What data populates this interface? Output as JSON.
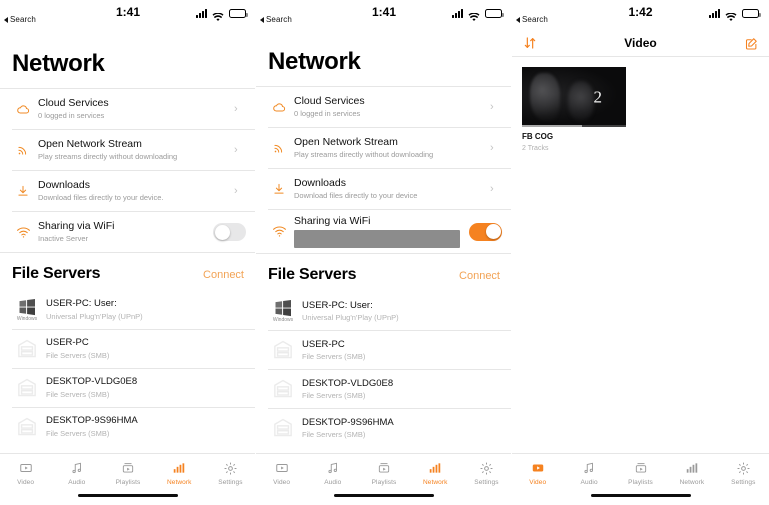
{
  "app": {
    "accent": "#f58220",
    "accent_light": "#f2a355",
    "muted": "#9a9a9a"
  },
  "panels": [
    {
      "id": "network-off",
      "status": {
        "time": "1:41",
        "back_label": "Search",
        "signal": "signal-bars",
        "wifi": "wifi-icon",
        "battery": "battery-icon"
      },
      "title": "Network",
      "rows": [
        {
          "icon": "cloud-icon",
          "title": "Cloud Services",
          "subtitle": "0 logged in services",
          "accessory": "chevron"
        },
        {
          "icon": "stream-icon",
          "title": "Open Network Stream",
          "subtitle": "Play streams directly without downloading",
          "accessory": "chevron"
        },
        {
          "icon": "download-icon",
          "title": "Downloads",
          "subtitle": "Download files directly to your device.",
          "accessory": "chevron"
        },
        {
          "icon": "wifi-icon",
          "title": "Sharing via WiFi",
          "subtitle": "Inactive Server",
          "accessory": "toggle",
          "toggle_on": false
        }
      ],
      "section": {
        "title": "File Servers",
        "action": "Connect"
      },
      "servers": [
        {
          "icon": "windows-logo",
          "name": "USER-PC: User:",
          "protocol": "Universal Plug'n'Play (UPnP)"
        },
        {
          "icon": "nas-icon",
          "name": "USER-PC",
          "protocol": "File Servers (SMB)"
        },
        {
          "icon": "nas-icon",
          "name": "DESKTOP-VLDG0E8",
          "protocol": "File Servers (SMB)"
        },
        {
          "icon": "nas-icon",
          "name": "DESKTOP-9S96HMA",
          "protocol": "File Servers (SMB)"
        }
      ],
      "tabs": [
        {
          "icon": "video-icon",
          "label": "Video",
          "active": false
        },
        {
          "icon": "audio-icon",
          "label": "Audio",
          "active": false
        },
        {
          "icon": "playlists-icon",
          "label": "Playlists",
          "active": false
        },
        {
          "icon": "network-icon",
          "label": "Network",
          "active": true
        },
        {
          "icon": "settings-icon",
          "label": "Settings",
          "active": false
        }
      ]
    },
    {
      "id": "network-on",
      "status": {
        "time": "1:41",
        "back_label": "Search",
        "signal": "signal-bars",
        "wifi": "wifi-icon",
        "battery": "battery-icon"
      },
      "title": "Network",
      "rows": [
        {
          "icon": "cloud-icon",
          "title": "Cloud Services",
          "subtitle": "0 logged in services",
          "accessory": "chevron"
        },
        {
          "icon": "stream-icon",
          "title": "Open Network Stream",
          "subtitle": "Play streams directly without downloading",
          "accessory": "chevron"
        },
        {
          "icon": "download-icon",
          "title": "Downloads",
          "subtitle": "Download files directly to your device",
          "accessory": "chevron"
        },
        {
          "icon": "wifi-icon",
          "title": "Sharing via WiFi",
          "subtitle": "",
          "accessory": "toggle",
          "toggle_on": true,
          "redacted": true
        }
      ],
      "section": {
        "title": "File Servers",
        "action": "Connect"
      },
      "servers": [
        {
          "icon": "windows-logo",
          "name": "USER-PC: User:",
          "protocol": "Universal Plug'n'Play (UPnP)"
        },
        {
          "icon": "nas-icon",
          "name": "USER-PC",
          "protocol": "File Servers (SMB)"
        },
        {
          "icon": "nas-icon",
          "name": "DESKTOP-VLDG0E8",
          "protocol": "File Servers (SMB)"
        },
        {
          "icon": "nas-icon",
          "name": "DESKTOP-9S96HMA",
          "protocol": "File Servers (SMB)"
        }
      ],
      "tabs": [
        {
          "icon": "video-icon",
          "label": "Video",
          "active": false
        },
        {
          "icon": "audio-icon",
          "label": "Audio",
          "active": false
        },
        {
          "icon": "playlists-icon",
          "label": "Playlists",
          "active": false
        },
        {
          "icon": "network-icon",
          "label": "Network",
          "active": true
        },
        {
          "icon": "settings-icon",
          "label": "Settings",
          "active": false
        }
      ]
    },
    {
      "id": "video-library",
      "status": {
        "time": "1:42",
        "back_label": "Search",
        "signal": "signal-bars",
        "wifi": "wifi-icon",
        "battery": "battery-icon"
      },
      "navbar": {
        "sort_icon": "sort-arrows-icon",
        "title": "Video",
        "edit_icon": "edit-compose-icon"
      },
      "videos": [
        {
          "thumb_badge": "2",
          "title": "FB COG",
          "subtitle": "2 Tracks"
        }
      ],
      "tabs": [
        {
          "icon": "video-icon",
          "label": "Video",
          "active": true
        },
        {
          "icon": "audio-icon",
          "label": "Audio",
          "active": false
        },
        {
          "icon": "playlists-icon",
          "label": "Playlists",
          "active": false
        },
        {
          "icon": "network-icon",
          "label": "Network",
          "active": false
        },
        {
          "icon": "settings-icon",
          "label": "Settings",
          "active": false
        }
      ]
    }
  ]
}
